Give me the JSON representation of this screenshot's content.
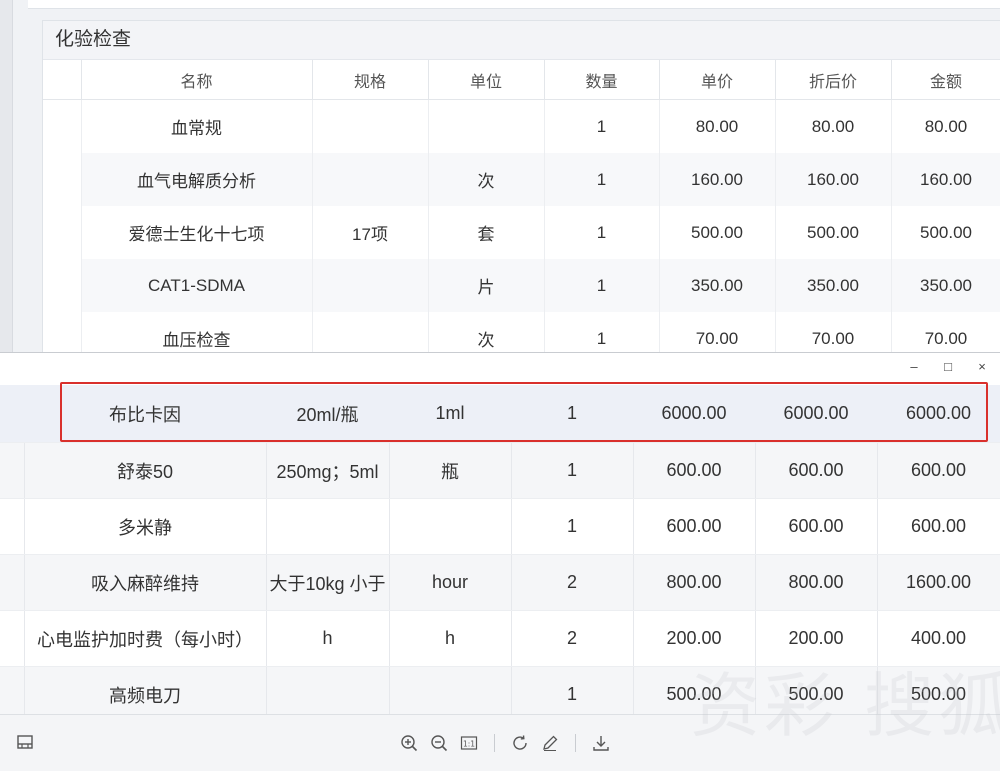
{
  "lab_section": {
    "title": "化验检查",
    "columns": [
      "名称",
      "规格",
      "单位",
      "数量",
      "单价",
      "折后价",
      "金额"
    ],
    "rows": [
      [
        "血常规",
        "",
        "",
        "1",
        "80.00",
        "80.00",
        "80.00"
      ],
      [
        "血气电解质分析",
        "",
        "次",
        "1",
        "160.00",
        "160.00",
        "160.00"
      ],
      [
        "爱德士生化十七项",
        "17项",
        "套",
        "1",
        "500.00",
        "500.00",
        "500.00"
      ],
      [
        "CAT1-SDMA",
        "",
        "片",
        "1",
        "350.00",
        "350.00",
        "350.00"
      ],
      [
        "血压检查",
        "",
        "次",
        "1",
        "70.00",
        "70.00",
        "70.00"
      ]
    ]
  },
  "viewer": {
    "controls": {
      "minimize": "–",
      "maximize": "□",
      "close": "×"
    },
    "highlight_color": "#d9302c",
    "rows": [
      [
        "布比卡因",
        "20ml/瓶",
        "1ml",
        "1",
        "6000.00",
        "6000.00",
        "6000.00"
      ],
      [
        "舒泰50",
        "250mg；5ml",
        "瓶",
        "1",
        "600.00",
        "600.00",
        "600.00"
      ],
      [
        "多米静",
        "",
        "",
        "1",
        "600.00",
        "600.00",
        "600.00"
      ],
      [
        "吸入麻醉维持",
        "大于10kg 小于",
        "hour",
        "2",
        "800.00",
        "800.00",
        "1600.00"
      ],
      [
        "心电监护加时费（每小时）",
        "h",
        "h",
        "2",
        "200.00",
        "200.00",
        "400.00"
      ],
      [
        "高频电刀",
        "",
        "",
        "1",
        "500.00",
        "500.00",
        "500.00"
      ]
    ],
    "toolbar": {
      "left_icon": "panel-toggle-icon",
      "icons": [
        "zoom-in-icon",
        "zoom-out-icon",
        "actual-size-icon",
        "rotate-icon",
        "edit-icon",
        "download-icon"
      ],
      "actual_size_label": "1:1"
    }
  },
  "watermark": {
    "text": "资彩 搜狐号",
    "sub": ""
  }
}
